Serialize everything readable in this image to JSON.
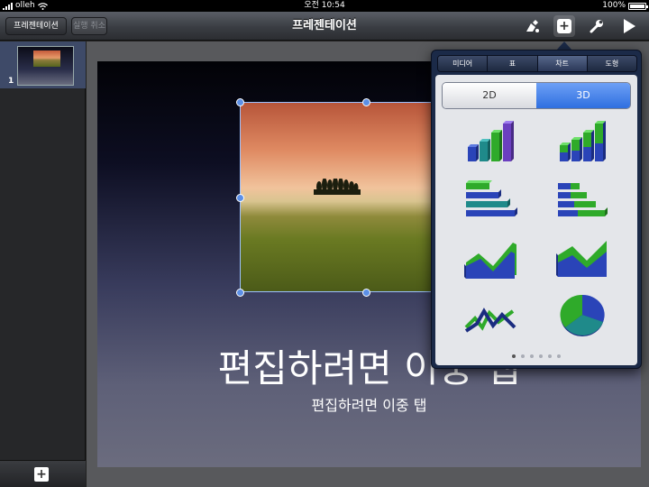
{
  "status": {
    "carrier": "olleh",
    "time": "오전 10:54",
    "battery": "100%"
  },
  "toolbar": {
    "presentations_label": "프레젠테이션",
    "undo_label": "실행 취소",
    "title": "프레젠테이션"
  },
  "sidebar": {
    "slides": [
      {
        "number": "1"
      }
    ]
  },
  "slide": {
    "title": "편집하려면 이중 탭",
    "subtitle": "편집하려면 이중 탭"
  },
  "popover": {
    "tabs": [
      "미디어",
      "표",
      "차트",
      "도형"
    ],
    "active_tab": "차트",
    "segments": [
      "2D",
      "3D"
    ],
    "active_segment": "3D",
    "chart_styles": [
      "3d-column-chart-icon",
      "3d-stacked-column-chart-icon",
      "3d-bar-chart-icon",
      "3d-stacked-bar-chart-icon",
      "3d-area-chart-icon",
      "3d-stacked-area-chart-icon",
      "3d-line-chart-icon",
      "3d-pie-chart-icon"
    ],
    "page_count": 6,
    "current_page": 1
  },
  "colors": {
    "accent": "#2f6fe0",
    "series_green": "#2faa2a",
    "series_blue": "#2a44b8",
    "series_teal": "#1f8a8a"
  }
}
